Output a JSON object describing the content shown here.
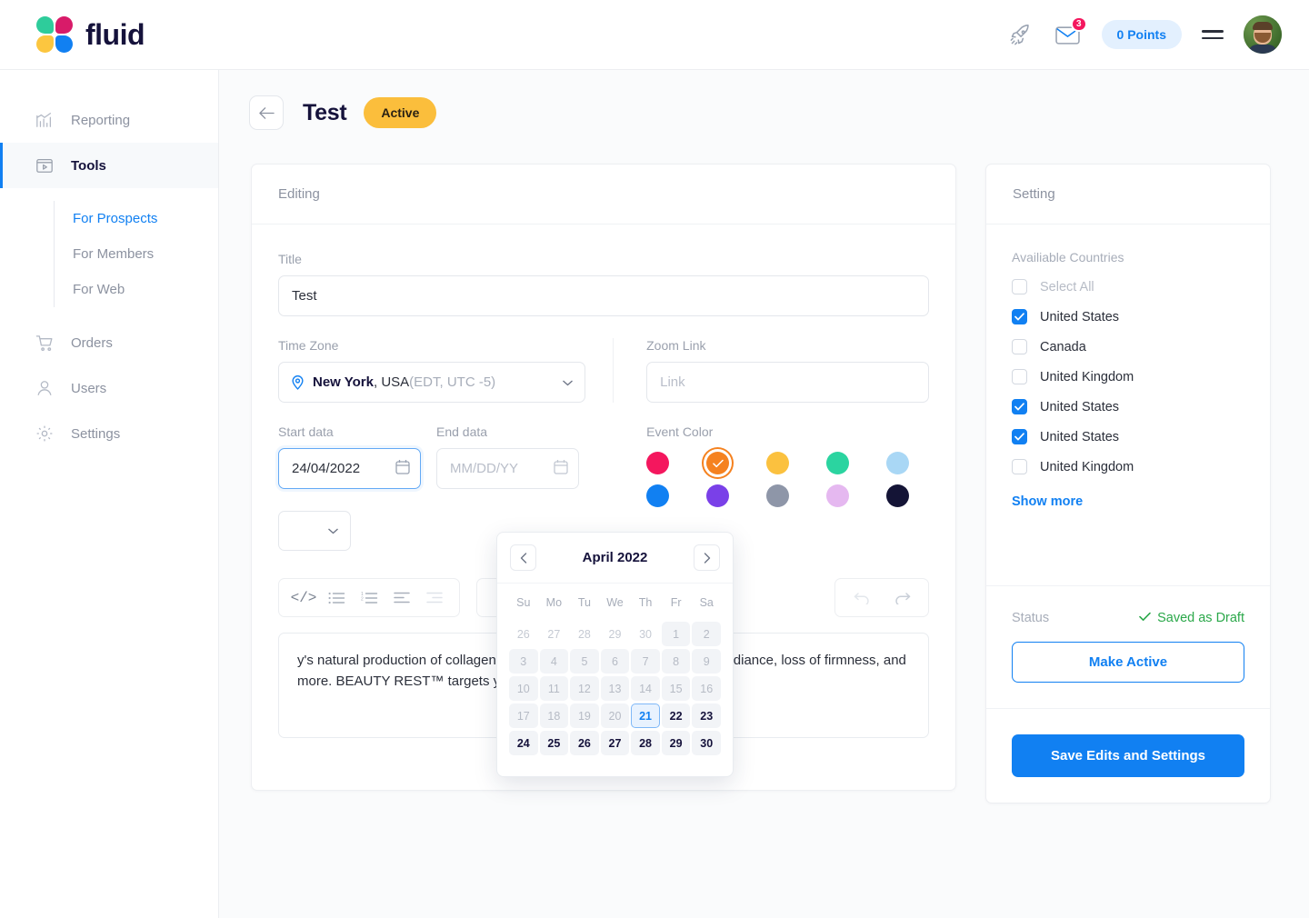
{
  "brand": {
    "name": "fluid",
    "colors": {
      "teal": "#2ECC9B",
      "pink": "#D81B69",
      "yellow": "#FCC63F",
      "blue": "#1180F2"
    }
  },
  "header": {
    "rocket_icon": "rocket-icon",
    "mail_icon": "envelope-icon",
    "mail_badge": "3",
    "points_label": "0 Points",
    "menu_icon": "hamburger-menu-icon",
    "avatar_alt": "user-avatar"
  },
  "sidebar": {
    "items": [
      {
        "label": "Reporting",
        "icon": "bar-chart-icon",
        "active": false
      },
      {
        "label": "Tools",
        "icon": "video-player-icon",
        "active": true
      },
      {
        "label": "Orders",
        "icon": "shopping-cart-icon",
        "active": false
      },
      {
        "label": "Users",
        "icon": "user-icon",
        "active": false
      },
      {
        "label": "Settings",
        "icon": "gear-icon",
        "active": false
      }
    ],
    "sub_items": [
      {
        "label": "For Prospects",
        "active": true
      },
      {
        "label": "For Members",
        "active": false
      },
      {
        "label": "For Web",
        "active": false
      }
    ]
  },
  "page": {
    "back_icon": "arrow-left-icon",
    "title": "Test",
    "status_badge": "Active"
  },
  "editing": {
    "card_title": "Editing",
    "title_label": "Title",
    "title_value": "Test",
    "timezone_label": "Time Zone",
    "timezone_city": "New York",
    "timezone_country": ", USA ",
    "timezone_offset": "(EDT, UTC -5)",
    "zoom_link_label": "Zoom Link",
    "zoom_link_placeholder": "Link",
    "start_date_label": "Start data",
    "start_date_value": "24/04/2022",
    "end_date_label": "End data",
    "end_date_placeholder": "MM/DD/YY",
    "event_color_label": "Event Color",
    "colors": [
      {
        "name": "crimson",
        "hex": "#F4175E",
        "selected": false
      },
      {
        "name": "orange",
        "hex": "#F58220",
        "selected": true
      },
      {
        "name": "amber",
        "hex": "#FBC13F",
        "selected": false
      },
      {
        "name": "teal",
        "hex": "#2BD4A0",
        "selected": false
      },
      {
        "name": "light-blue",
        "hex": "#A9D7F5",
        "selected": false
      },
      {
        "name": "blue",
        "hex": "#1180F2",
        "selected": false
      },
      {
        "name": "purple",
        "hex": "#7A40E8",
        "selected": false
      },
      {
        "name": "gray",
        "hex": "#8E96A8",
        "selected": false
      },
      {
        "name": "lilac",
        "hex": "#E5B8F0",
        "selected": false
      },
      {
        "name": "navy",
        "hex": "#141436",
        "selected": false
      }
    ],
    "toolbar": [
      {
        "name": "code-icon",
        "glyph": "</>",
        "dim": false
      },
      {
        "name": "bullet-list-icon",
        "glyph": "list",
        "dim": false
      },
      {
        "name": "numbered-list-icon",
        "glyph": "olist",
        "dim": false
      },
      {
        "name": "align-left-icon",
        "glyph": "alignl",
        "dim": false
      },
      {
        "name": "align-right-icon",
        "glyph": "alignr",
        "dim": true
      }
    ],
    "attach_icon": "paperclip-icon",
    "undo_icon": "undo-icon",
    "redo_icon": "redo-icon",
    "body_text": "y's natural production of collagen, hyaluronic acid, and ceramides k of radiance, loss of firmness, and more. BEAUTY REST™ targets youthful skin."
  },
  "calendar": {
    "month_title": "April 2022",
    "prev_icon": "chevron-left-icon",
    "next_icon": "chevron-right-icon",
    "dow": [
      "Su",
      "Mo",
      "Tu",
      "We",
      "Th",
      "Fr",
      "Sa"
    ],
    "weeks": [
      [
        {
          "d": "26",
          "s": "muted"
        },
        {
          "d": "27",
          "s": "muted"
        },
        {
          "d": "28",
          "s": "muted"
        },
        {
          "d": "29",
          "s": "muted"
        },
        {
          "d": "30",
          "s": "muted"
        },
        {
          "d": "1",
          "s": "dim"
        },
        {
          "d": "2",
          "s": "dim"
        }
      ],
      [
        {
          "d": "3",
          "s": "dim"
        },
        {
          "d": "4",
          "s": "dim"
        },
        {
          "d": "5",
          "s": "dim"
        },
        {
          "d": "6",
          "s": "dim"
        },
        {
          "d": "7",
          "s": "dim"
        },
        {
          "d": "8",
          "s": "dim"
        },
        {
          "d": "9",
          "s": "dim"
        }
      ],
      [
        {
          "d": "10",
          "s": "dim"
        },
        {
          "d": "11",
          "s": "dim"
        },
        {
          "d": "12",
          "s": "dim"
        },
        {
          "d": "13",
          "s": "dim"
        },
        {
          "d": "14",
          "s": "dim"
        },
        {
          "d": "15",
          "s": "dim"
        },
        {
          "d": "16",
          "s": "dim"
        }
      ],
      [
        {
          "d": "17",
          "s": "dim"
        },
        {
          "d": "18",
          "s": "dim"
        },
        {
          "d": "19",
          "s": "dim"
        },
        {
          "d": "20",
          "s": "dim"
        },
        {
          "d": "21",
          "s": "sel"
        },
        {
          "d": "22",
          "s": "on"
        },
        {
          "d": "23",
          "s": "on"
        }
      ],
      [
        {
          "d": "24",
          "s": "on"
        },
        {
          "d": "25",
          "s": "on"
        },
        {
          "d": "26",
          "s": "on"
        },
        {
          "d": "27",
          "s": "on"
        },
        {
          "d": "28",
          "s": "on"
        },
        {
          "d": "29",
          "s": "on"
        },
        {
          "d": "30",
          "s": "on"
        }
      ]
    ]
  },
  "setting": {
    "card_title": "Setting",
    "countries_label": "Availiable Countries",
    "countries": [
      {
        "label": "Select All",
        "checked": false,
        "disabled": true
      },
      {
        "label": "United States",
        "checked": true,
        "disabled": false
      },
      {
        "label": "Canada",
        "checked": false,
        "disabled": false
      },
      {
        "label": "United Kingdom",
        "checked": false,
        "disabled": false
      },
      {
        "label": "United States",
        "checked": true,
        "disabled": false
      },
      {
        "label": "United States",
        "checked": true,
        "disabled": false
      },
      {
        "label": "United Kingdom",
        "checked": false,
        "disabled": false
      }
    ],
    "show_more": "Show more",
    "status_label": "Status",
    "status_value": "Saved as Draft",
    "status_color": "#2BA84A",
    "make_active_label": "Make Active",
    "save_label": "Save Edits and Settings"
  }
}
